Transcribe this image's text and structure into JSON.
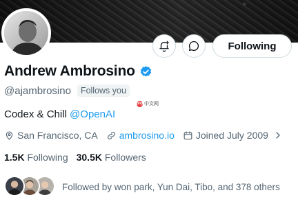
{
  "header": {
    "following_label": "Following",
    "notify_button": "bell-plus-icon",
    "message_button": "message-icon"
  },
  "profile": {
    "display_name": "Andrew Ambrosino",
    "verified": true,
    "handle": "@ajambrosino",
    "follows_you": "Follows you",
    "bio_text": "Codex & Chill ",
    "bio_mention": "@OpenAI",
    "location": "San Francisco, CA",
    "website": "ambrosino.io",
    "joined": "Joined July 2009"
  },
  "stats": {
    "following_count": "1.5K",
    "following_label": "Following",
    "followers_count": "30.5K",
    "followers_label": "Followers"
  },
  "followers_you_know": {
    "text": "Followed by won park, Yun Dai, Tibo, and 378 others"
  },
  "watermark": {
    "logo": "php",
    "text": "中文网"
  },
  "colors": {
    "accent": "#1d9bf0",
    "text_primary": "#0f1419",
    "text_secondary": "#536471",
    "border": "#cfd9de"
  }
}
